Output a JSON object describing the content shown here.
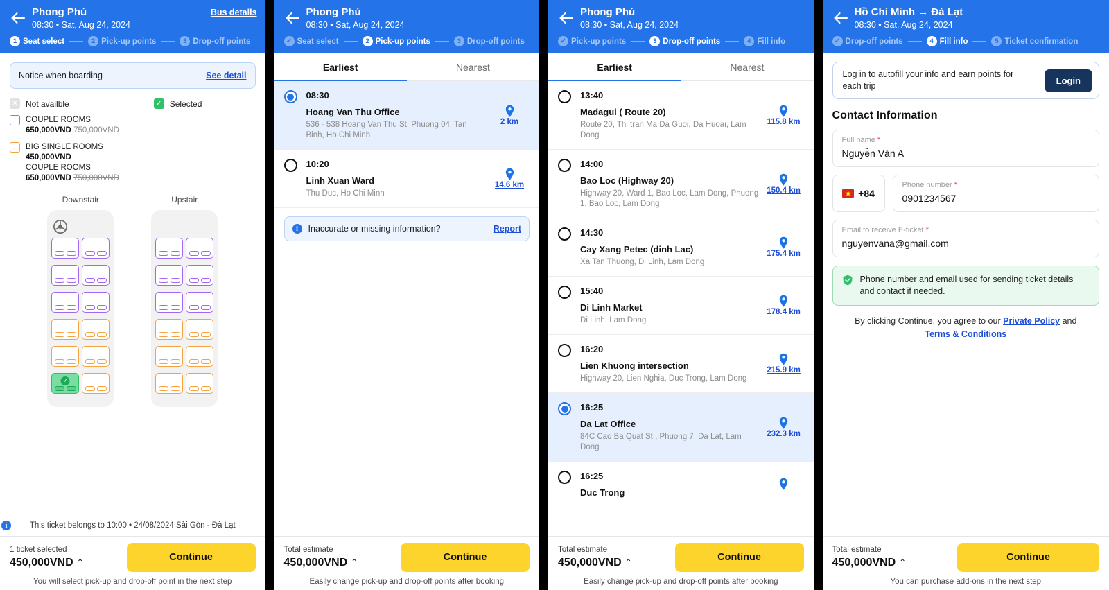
{
  "panels": {
    "seat_select": {
      "header": {
        "title": "Phong Phú",
        "subtitle": "08:30 • Sat, Aug 24, 2024",
        "action_link": "Bus details",
        "back_icon": "back-arrow-icon",
        "steps": [
          {
            "num": "1",
            "label": "Seat select",
            "state": "active"
          },
          {
            "num": "2",
            "label": "Pick-up points",
            "state": "todo"
          },
          {
            "num": "3",
            "label": "Drop-off points",
            "state": "todo"
          }
        ]
      },
      "notice": {
        "text": "Notice when boarding",
        "link": "See detail"
      },
      "legend": {
        "not_available": "Not availble",
        "selected": "Selected",
        "groups": [
          {
            "color_key": "purple",
            "lines": [
              {
                "name": "COUPLE ROOMS",
                "price": "650,000VND",
                "old_price": "750,000VND"
              }
            ]
          },
          {
            "color_key": "orange",
            "lines": [
              {
                "name": "BIG SINGLE ROOMS",
                "price": "450,000VND",
                "old_price": ""
              },
              {
                "name": "COUPLE ROOMS",
                "price": "650,000VND",
                "old_price": "750,000VND"
              }
            ]
          }
        ]
      },
      "decks": [
        {
          "title": "Downstair",
          "has_wheel": true,
          "rows": [
            [
              "purple",
              "purple"
            ],
            [
              "purple",
              "purple"
            ],
            [
              "purple",
              "purple"
            ],
            [
              "orange",
              "orange"
            ],
            [
              "orange",
              "orange"
            ],
            [
              "selected",
              "orange"
            ]
          ]
        },
        {
          "title": "Upstair",
          "has_wheel": false,
          "rows": [
            [
              "purple",
              "purple"
            ],
            [
              "purple",
              "purple"
            ],
            [
              "purple",
              "purple"
            ],
            [
              "orange",
              "orange"
            ],
            [
              "orange",
              "orange"
            ],
            [
              "orange",
              "orange"
            ]
          ]
        }
      ],
      "ticket_note": "This ticket belongs to 10:00 • 24/08/2024 Sài Gòn - Đà Lạt",
      "bottom": {
        "caption": "1 ticket selected",
        "price": "450,000VND",
        "caret": "⌃",
        "continue": "Continue",
        "hint": "You will select pick-up and drop-off point in the next step"
      }
    },
    "pickup": {
      "header": {
        "title": "Phong Phú",
        "subtitle": "08:30 • Sat, Aug 24, 2024",
        "action_link": "",
        "back_icon": "back-arrow-icon",
        "steps": [
          {
            "num": "✓",
            "label": "Seat select",
            "state": "done"
          },
          {
            "num": "2",
            "label": "Pick-up points",
            "state": "active"
          },
          {
            "num": "3",
            "label": "Drop-off points",
            "state": "todo"
          }
        ]
      },
      "tabs": [
        {
          "label": "Earliest",
          "active": true
        },
        {
          "label": "Nearest",
          "active": false
        }
      ],
      "points": [
        {
          "time": "08:30",
          "name": "Hoang Van Thu Office",
          "address": "536 - 538 Hoang Van Thu St, Phuong 04, Tan Binh, Ho Chi Minh",
          "distance": "2 km",
          "selected": true
        },
        {
          "time": "10:20",
          "name": "Linh Xuan Ward",
          "address": "Thu Duc, Ho Chi Minh",
          "distance": "14.6 km",
          "selected": false
        }
      ],
      "report": {
        "text": "Inaccurate or missing information?",
        "link": "Report"
      },
      "bottom": {
        "caption": "Total estimate",
        "price": "450,000VND",
        "caret": "⌃",
        "continue": "Continue",
        "hint": "Easily change pick-up and drop-off points after booking"
      }
    },
    "dropoff": {
      "header": {
        "title": "Phong Phú",
        "subtitle": "08:30 • Sat, Aug 24, 2024",
        "action_link": "",
        "back_icon": "back-arrow-icon",
        "steps": [
          {
            "num": "✓",
            "label": "Pick-up points",
            "state": "done"
          },
          {
            "num": "3",
            "label": "Drop-off points",
            "state": "active"
          },
          {
            "num": "4",
            "label": "Fill info",
            "state": "todo"
          }
        ]
      },
      "tabs": [
        {
          "label": "Earliest",
          "active": true
        },
        {
          "label": "Nearest",
          "active": false
        }
      ],
      "points": [
        {
          "time": "13:40",
          "name": "Madagui ( Route 20)",
          "address": "Route 20, Thi tran Ma Da Guoi, Da Huoai, Lam Dong",
          "distance": "115.8 km",
          "selected": false
        },
        {
          "time": "14:00",
          "name": "Bao Loc (Highway 20)",
          "address": "Highway 20, Ward 1, Bao Loc, Lam Dong, Phuong 1, Bao Loc, Lam Dong",
          "distance": "150.4 km",
          "selected": false
        },
        {
          "time": "14:30",
          "name": "Cay Xang Petec (dinh Lac)",
          "address": "Xa Tan Thuong, Di Linh, Lam Dong",
          "distance": "175.4 km",
          "selected": false
        },
        {
          "time": "15:40",
          "name": "Di Linh Market",
          "address": "Di Linh, Lam Dong",
          "distance": "178.4 km",
          "selected": false
        },
        {
          "time": "16:20",
          "name": "Lien Khuong intersection",
          "address": "Highway 20, Lien Nghia, Duc Trong, Lam Dong",
          "distance": "215.9 km",
          "selected": false
        },
        {
          "time": "16:25",
          "name": "Da Lat Office",
          "address": "84C Cao Ba Quat St , Phuong 7, Da Lat, Lam Dong",
          "distance": "232.3 km",
          "selected": true
        },
        {
          "time": "16:25",
          "name": "Duc Trong",
          "address": "",
          "distance": "",
          "selected": false
        }
      ],
      "bottom": {
        "caption": "Total estimate",
        "price": "450,000VND",
        "caret": "⌃",
        "continue": "Continue",
        "hint": "Easily change pick-up and drop-off points after booking"
      }
    },
    "fill_info": {
      "header": {
        "title": "Hồ Chí Minh → Đà Lạt",
        "subtitle": "08:30 • Sat, Aug 24, 2024",
        "action_link": "",
        "back_icon": "back-arrow-icon",
        "steps": [
          {
            "num": "✓",
            "label": "Drop-off points",
            "state": "done"
          },
          {
            "num": "4",
            "label": "Fill info",
            "state": "active"
          },
          {
            "num": "5",
            "label": "Ticket confirmation",
            "state": "todo"
          }
        ]
      },
      "login_banner": {
        "text": "Log in to autofill your info and earn points for each trip",
        "button": "Login"
      },
      "section_title": "Contact Information",
      "fields": {
        "full_name": {
          "label": "Full name",
          "required": "*",
          "value": "Nguyễn Văn A"
        },
        "country_code": {
          "value": "+84",
          "flag": "vn-flag-icon"
        },
        "phone": {
          "label": "Phone number",
          "required": "*",
          "value": "0901234567"
        },
        "email": {
          "label": "Email to receive E-ticket",
          "required": "*",
          "value": "nguyenvana@gmail.com"
        }
      },
      "assurance": "Phone number and email used for sending ticket details and contact if needed.",
      "terms": {
        "prefix": "By clicking Continue, you agree to our ",
        "link1": "Private Policy",
        "middle": " and",
        "link2": "Terms & Conditions"
      },
      "bottom": {
        "caption": "Total estimate",
        "price": "450,000VND",
        "caret": "⌃",
        "continue": "Continue",
        "hint": "You can purchase add-ons in the next step"
      }
    }
  },
  "colors": {
    "brand_blue": "#2573e8",
    "accent_yellow": "#fdd42b",
    "selected_green": "#2fc069",
    "couple_purple": "#a368f0",
    "single_orange": "#f5a241",
    "link_blue": "#1d4ed8",
    "login_navy": "#17355c"
  }
}
